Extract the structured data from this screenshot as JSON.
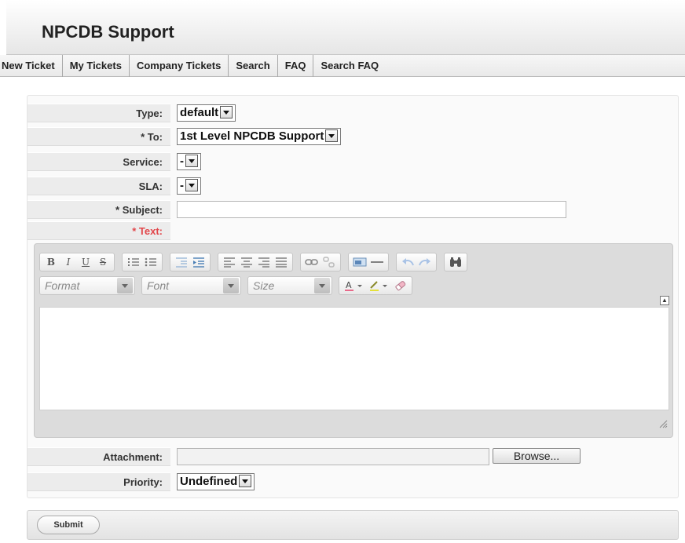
{
  "app": {
    "title": "NPCDB Support"
  },
  "nav": [
    {
      "label": "New Ticket"
    },
    {
      "label": "My Tickets"
    },
    {
      "label": "Company Tickets"
    },
    {
      "label": "Search"
    },
    {
      "label": "FAQ"
    },
    {
      "label": "Search FAQ"
    }
  ],
  "form": {
    "type": {
      "label": "Type:",
      "value": "default"
    },
    "to": {
      "label": "* To:",
      "value": "1st Level NPCDB Support"
    },
    "service": {
      "label": "Service:",
      "value": "-"
    },
    "sla": {
      "label": "SLA:",
      "value": "-"
    },
    "subject": {
      "label": "* Subject:",
      "value": ""
    },
    "text": {
      "label": "* Text:"
    },
    "attachment": {
      "label": "Attachment:",
      "browse": "Browse..."
    },
    "priority": {
      "label": "Priority:",
      "value": "Undefined"
    }
  },
  "editor": {
    "format_placeholder": "Format",
    "font_placeholder": "Font",
    "size_placeholder": "Size",
    "buttons": {
      "bold": "B",
      "italic": "I",
      "underline": "U",
      "strike": "S"
    }
  },
  "actions": {
    "submit": "Submit"
  },
  "colors": {
    "required": "#e2474b"
  }
}
